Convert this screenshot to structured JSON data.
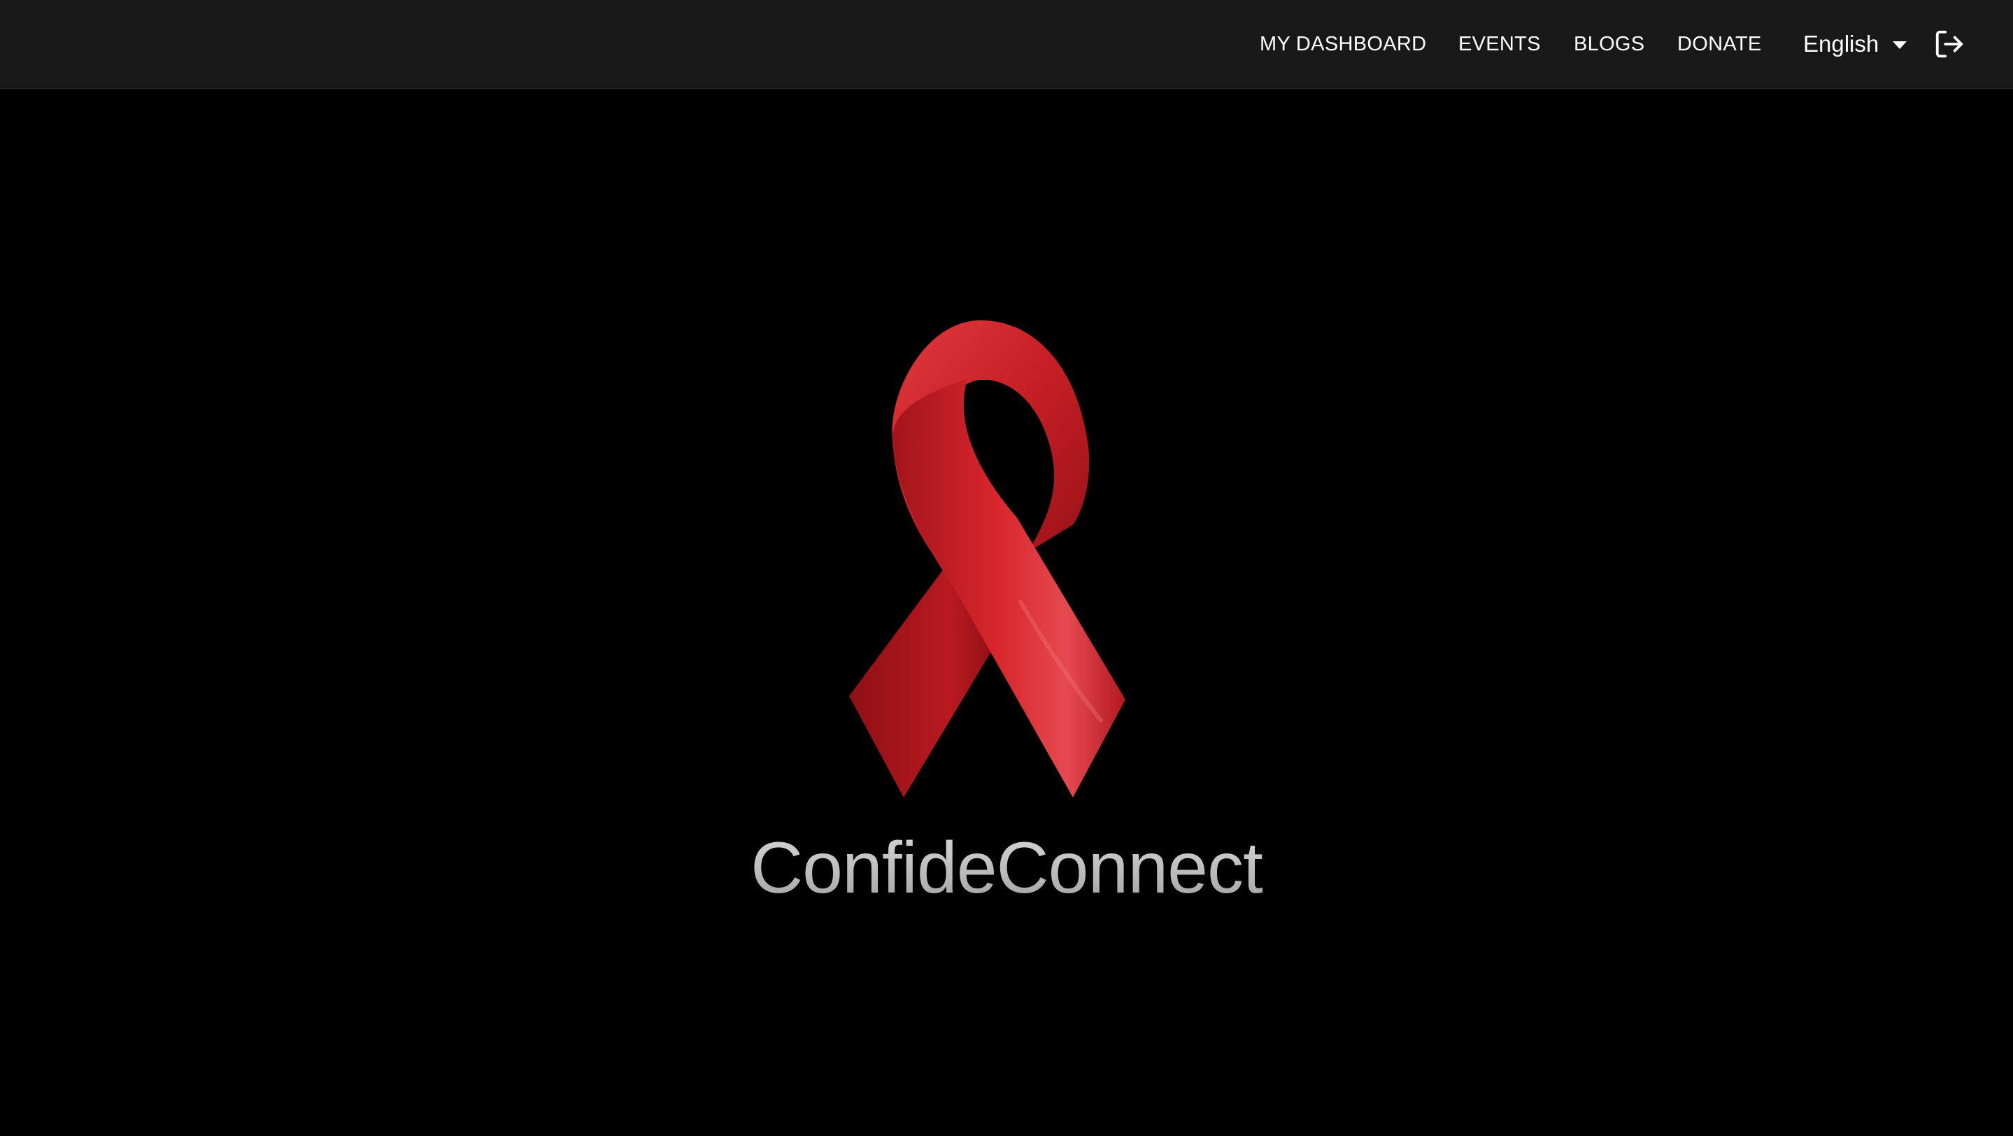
{
  "nav": {
    "items": [
      {
        "label": "MY DASHBOARD"
      },
      {
        "label": "EVENTS"
      },
      {
        "label": "BLOGS"
      },
      {
        "label": "DONATE"
      }
    ],
    "language": {
      "selected": "English",
      "icon": "chevron-down-icon"
    },
    "logout_icon": "logout-icon"
  },
  "hero": {
    "logo_icon": "red-ribbon-icon",
    "brand_name": "ConfideConnect"
  },
  "colors": {
    "topbar_bg": "#181818",
    "page_bg": "#000000",
    "ribbon_red": "#d1262b",
    "brand_text": "#c4c4c4"
  }
}
